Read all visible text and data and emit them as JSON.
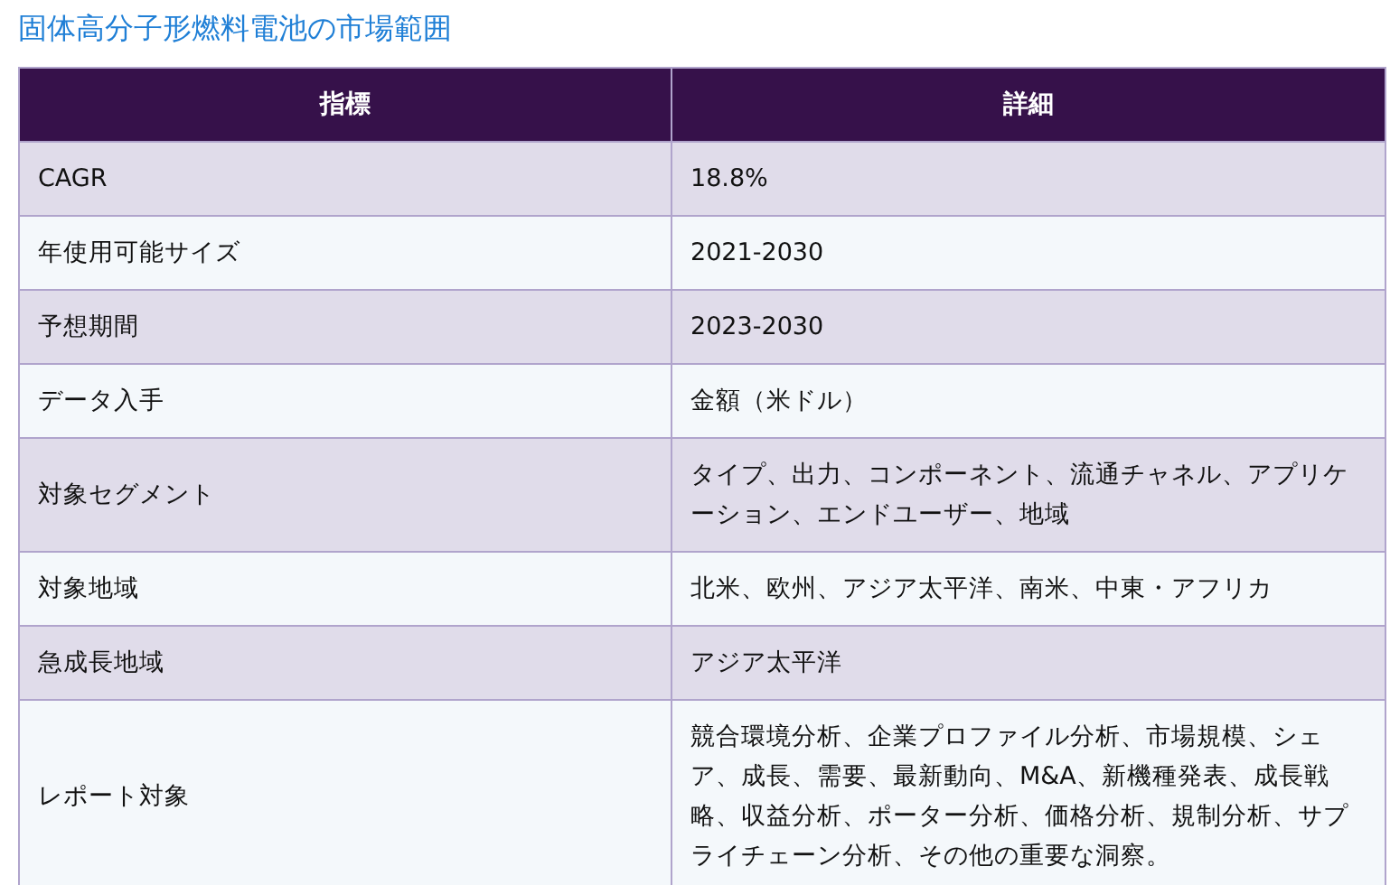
{
  "title": "固体高分子形燃料電池の市場範囲",
  "table": {
    "columns": [
      "指標",
      "詳細"
    ],
    "rows": [
      {
        "cells": [
          "CAGR",
          "18.8%"
        ]
      },
      {
        "cells": [
          "年使用可能サイズ",
          "2021-2030"
        ]
      },
      {
        "cells": [
          "予想期間",
          "2023-2030"
        ]
      },
      {
        "cells": [
          "データ入手",
          "金額（米ドル）"
        ]
      },
      {
        "cells": [
          "対象セグメント",
          "タイプ、出力、コンポーネント、流通チャネル、アプリケーション、エンドユーザー、地域"
        ]
      },
      {
        "cells": [
          "対象地域",
          "北米、欧州、アジア太平洋、南米、中東・アフリカ"
        ]
      },
      {
        "cells": [
          "急成長地域",
          "アジア太平洋"
        ]
      },
      {
        "cells": [
          "レポート対象",
          "競合環境分析、企業プロファイル分析、市場規模、シェア、成長、需要、最新動向、M&A、新機種発表、成長戦略、収益分析、ポーター分析、価格分析、規制分析、サプライチェーン分析、その他の重要な洞察。"
        ]
      }
    ]
  }
}
